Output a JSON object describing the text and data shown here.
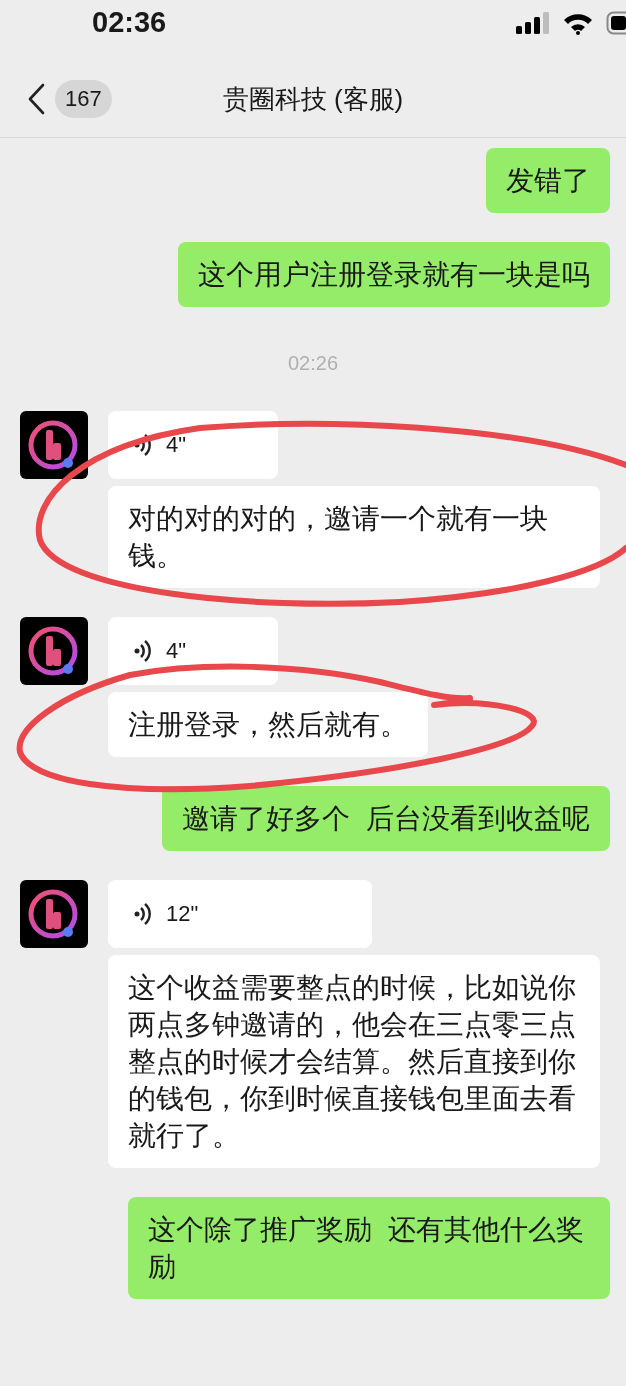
{
  "status_bar": {
    "time": "02:36"
  },
  "header": {
    "unread_count": "167",
    "title": "贵圈科技 (客服)"
  },
  "messages": [
    {
      "kind": "outgoing_text",
      "text": "发错了"
    },
    {
      "kind": "outgoing_text",
      "text": "这个用户注册登录就有一块是吗"
    },
    {
      "kind": "time",
      "text": "02:26"
    },
    {
      "kind": "incoming_voice",
      "duration": "4\"",
      "transcript": "对的对的对的，邀请一个就有一块钱。"
    },
    {
      "kind": "incoming_voice",
      "duration": "4\"",
      "transcript": "注册登录，然后就有。"
    },
    {
      "kind": "outgoing_text",
      "text": "邀请了好多个  后台没看到收益呢"
    },
    {
      "kind": "incoming_voice",
      "duration": "12\"",
      "transcript": "这个收益需要整点的时候，比如说你两点多钟邀请的，他会在三点零三点整点的时候才会结算。然后直接到你的钱包，你到时候直接钱包里面去看就行了。"
    },
    {
      "kind": "outgoing_text",
      "text": "这个除了推广奖励  还有其他什么奖励"
    }
  ]
}
